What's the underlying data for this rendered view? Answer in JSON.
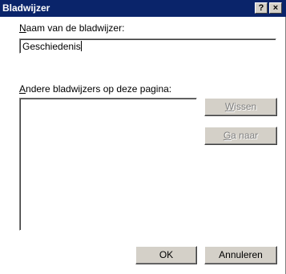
{
  "window": {
    "title": "Bladwijzer",
    "help_label": "?",
    "close_label": "×"
  },
  "form": {
    "name_label": "Naam van de bladwijzer:",
    "name_value": "Geschiedenis",
    "list_label": "Andere bladwijzers op deze pagina:",
    "list_items": []
  },
  "buttons": {
    "delete_label": "Wissen",
    "goto_label": "Ga naar",
    "ok_label": "OK",
    "cancel_label": "Annuleren"
  },
  "state": {
    "delete_enabled": false,
    "goto_enabled": false
  }
}
